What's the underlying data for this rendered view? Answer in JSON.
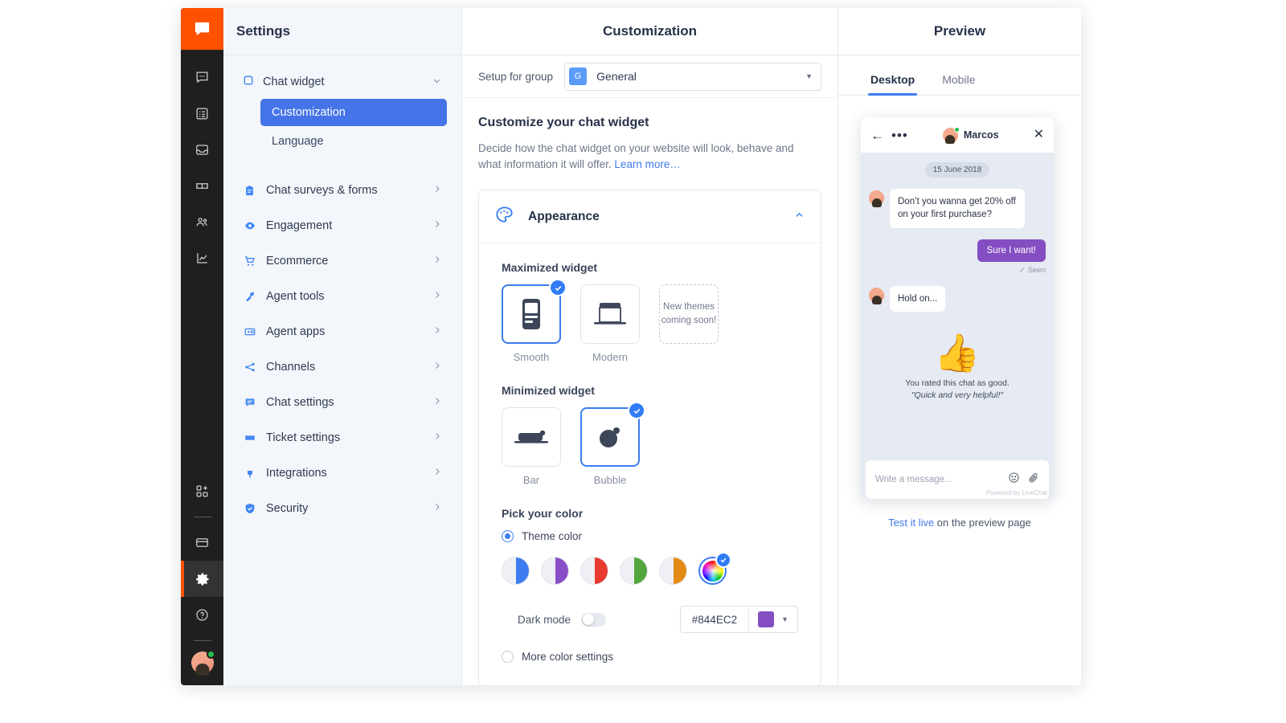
{
  "rail": {
    "logo_icon": "livechat-logo-icon",
    "top_items": [
      {
        "icon": "chats-icon",
        "name": "chats"
      },
      {
        "icon": "archives-list-icon",
        "name": "archives"
      },
      {
        "icon": "inbox-icon",
        "name": "inbox"
      },
      {
        "icon": "tickets-icon",
        "name": "tickets"
      },
      {
        "icon": "team-icon",
        "name": "team"
      },
      {
        "icon": "reports-chart-icon",
        "name": "reports"
      }
    ],
    "bottom_items": [
      {
        "icon": "apps-add-icon",
        "name": "apps"
      },
      {
        "icon": "billing-card-icon",
        "name": "billing"
      },
      {
        "icon": "gear-icon",
        "name": "settings",
        "active": true
      },
      {
        "icon": "help-circle-icon",
        "name": "help"
      }
    ],
    "avatar_name": "user-avatar"
  },
  "settings": {
    "title": "Settings",
    "group": {
      "label": "Chat widget",
      "icon": "chat-widget-icon",
      "chevron": "chevron-down-icon",
      "children": [
        {
          "label": "Customization",
          "selected": true
        },
        {
          "label": "Language",
          "selected": false
        }
      ]
    },
    "items": [
      {
        "label": "Chat surveys & forms",
        "icon": "clipboard-icon"
      },
      {
        "label": "Engagement",
        "icon": "eye-icon"
      },
      {
        "label": "Ecommerce",
        "icon": "cart-icon"
      },
      {
        "label": "Agent tools",
        "icon": "wrench-icon"
      },
      {
        "label": "Agent apps",
        "icon": "agent-apps-icon"
      },
      {
        "label": "Channels",
        "icon": "channels-share-icon"
      },
      {
        "label": "Chat settings",
        "icon": "chat-bubble-icon"
      },
      {
        "label": "Ticket settings",
        "icon": "ticket-icon"
      },
      {
        "label": "Integrations",
        "icon": "plug-icon"
      },
      {
        "label": "Security",
        "icon": "shield-icon"
      }
    ]
  },
  "main": {
    "title": "Customization",
    "group_bar": {
      "label": "Setup for group",
      "badge": "G",
      "value": "General"
    },
    "heading": "Customize your chat widget",
    "description": "Decide how the chat widget on your website will look, behave and what information it will offer.",
    "learn_more": "Learn more…",
    "appearance": {
      "title": "Appearance",
      "icon": "palette-icon",
      "collapse_icon": "chevron-up-icon",
      "maximized": {
        "label": "Maximized widget",
        "options": [
          {
            "name": "Smooth",
            "selected": true,
            "icon": "phone-widget-icon"
          },
          {
            "name": "Modern",
            "selected": false,
            "icon": "modern-widget-icon"
          },
          {
            "name": "",
            "selected": false,
            "placeholder_line1": "New themes",
            "placeholder_line2": "coming soon!"
          }
        ]
      },
      "minimized": {
        "label": "Minimized widget",
        "options": [
          {
            "name": "Bar",
            "selected": false,
            "icon": "bar-widget-icon"
          },
          {
            "name": "Bubble",
            "selected": true,
            "icon": "bubble-widget-icon"
          }
        ]
      },
      "color": {
        "label": "Pick your color",
        "theme_option": "Theme color",
        "theme_selected": true,
        "swatches": [
          {
            "name": "blue",
            "hex": "#3c7bf0"
          },
          {
            "name": "purple",
            "hex": "#8a4fc6"
          },
          {
            "name": "red",
            "hex": "#e8392f"
          },
          {
            "name": "green",
            "hex": "#53a63e"
          },
          {
            "name": "orange",
            "hex": "#e38b12"
          }
        ],
        "custom_swatch": {
          "name": "custom-rainbow",
          "selected": true
        },
        "dark_mode_label": "Dark mode",
        "dark_mode_on": false,
        "hex_value": "#844EC2",
        "hex_chip": "#844EC2",
        "more_settings": "More color settings",
        "more_selected": false
      }
    }
  },
  "preview": {
    "title": "Preview",
    "tabs": [
      {
        "label": "Desktop",
        "active": true
      },
      {
        "label": "Mobile",
        "active": false
      }
    ],
    "widget": {
      "header": {
        "back_icon": "back-arrow-icon",
        "menu_icon": "more-dots-icon",
        "agent_name": "Marcos",
        "close_icon": "close-icon"
      },
      "date_divider": "15 June 2018",
      "messages": [
        {
          "from": "agent",
          "text": "Don’t you wanna get 20% off on your first purchase?"
        },
        {
          "from": "visitor",
          "text": "Sure I want!",
          "status": "✓ Seen"
        },
        {
          "from": "agent",
          "text": "Hold on..."
        }
      ],
      "rating": {
        "emoji": "👍",
        "line1": "You rated this chat as good.",
        "line2": "\"Quick and very helpful!\""
      },
      "input_placeholder": "Write a message...",
      "input_icons": [
        "emoji-icon",
        "attachment-icon"
      ],
      "powered_by": "Powered by LiveChat"
    },
    "test_link": "Test it live",
    "test_rest": " on the preview page"
  }
}
